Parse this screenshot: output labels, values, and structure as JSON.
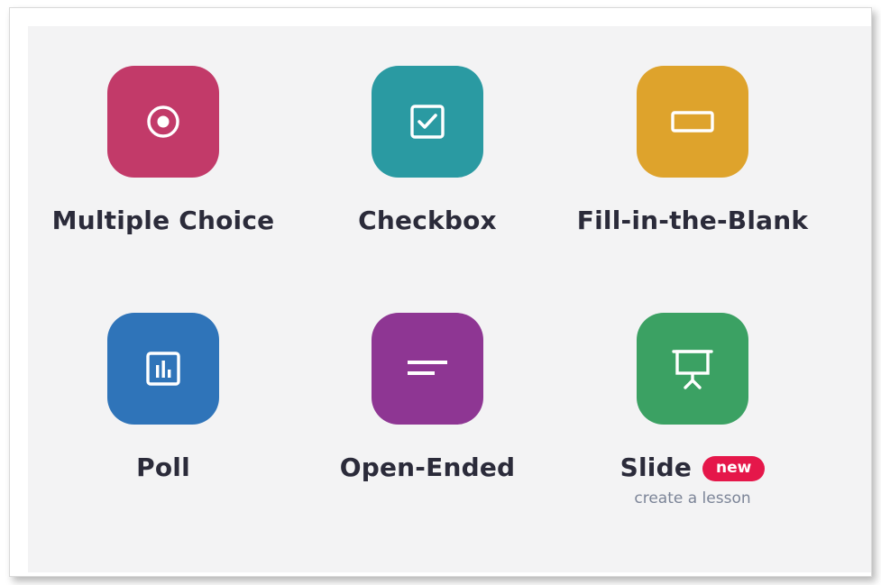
{
  "tiles": [
    {
      "label": "Multiple Choice",
      "color": "#c23a69",
      "icon": "radio-icon"
    },
    {
      "label": "Checkbox",
      "color": "#2a9aa2",
      "icon": "checkbox-icon"
    },
    {
      "label": "Fill-in-the-Blank",
      "color": "#dea32c",
      "icon": "blank-field-icon"
    },
    {
      "label": "Poll",
      "color": "#2f74b9",
      "icon": "poll-chart-icon"
    },
    {
      "label": "Open-Ended",
      "color": "#8e3693",
      "icon": "text-lines-icon"
    },
    {
      "label": "Slide",
      "color": "#3ba163",
      "icon": "presentation-board-icon",
      "badge": "new",
      "sub": "create a lesson"
    }
  ]
}
